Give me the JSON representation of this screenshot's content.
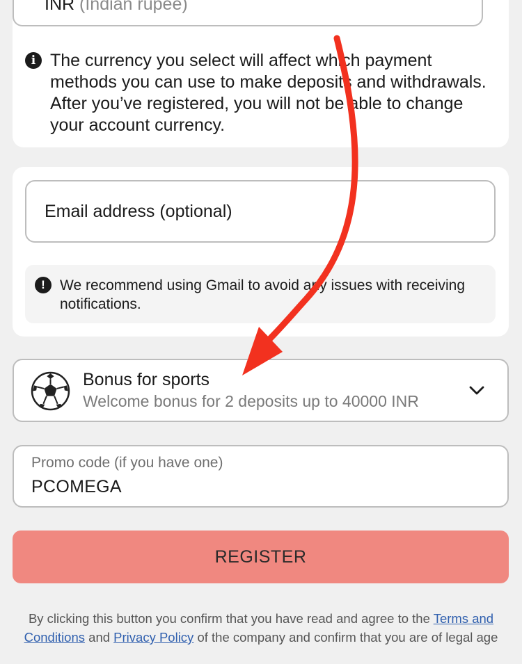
{
  "currency": {
    "code": "INR",
    "name": "(Indian rupee)"
  },
  "currency_info": "The currency you select will affect which payment methods you can use to make deposits and withdrawals. After you’ve registered, you will not be able to change your account currency.",
  "email": {
    "placeholder": "Email address (optional)"
  },
  "gmail_note": "We recommend using Gmail to avoid any issues with receiving notifications.",
  "bonus": {
    "title": "Bonus for sports",
    "subtitle": "Welcome bonus for 2 deposits up to 40000 INR"
  },
  "promo": {
    "label": "Promo code (if you have one)",
    "value": "PCOMEGA"
  },
  "register_label": "REGISTER",
  "legal": {
    "part1": "By clicking this button you confirm that you have read and agree to the",
    "terms_link": "Terms and Conditions",
    "part2": "and",
    "privacy_link": "Privacy Policy",
    "part3": "of the company and confirm that you are of legal age"
  },
  "colors": {
    "register_bg": "#f08880",
    "link": "#2f5fae",
    "arrow": "#f2311f"
  },
  "icons": [
    "info-icon",
    "exclamation-icon",
    "soccer-ball-icon",
    "chevron-down-icon",
    "red-annotation-arrow"
  ]
}
